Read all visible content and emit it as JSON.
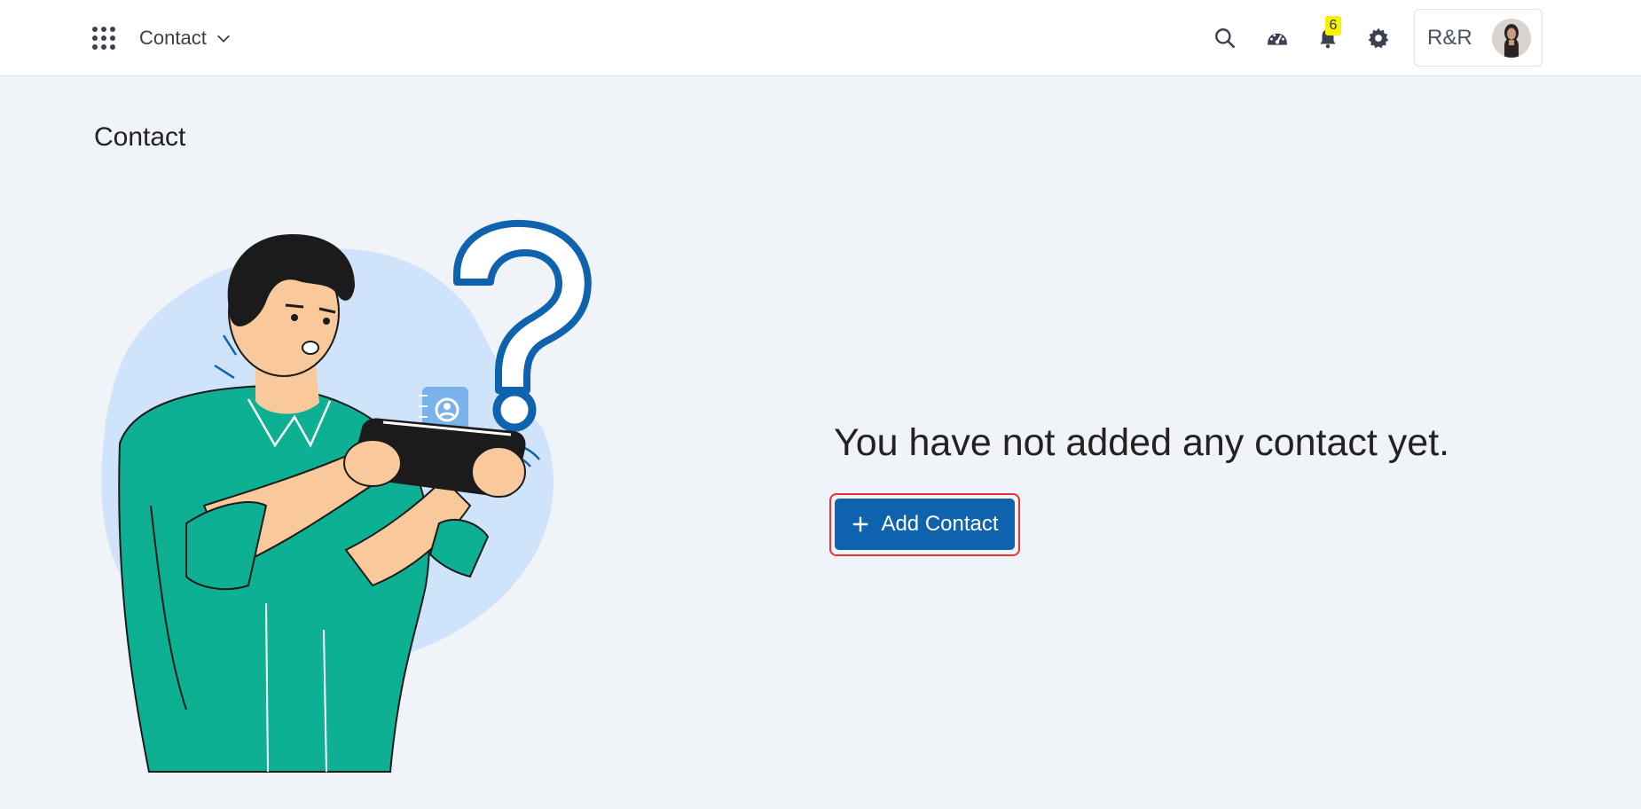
{
  "header": {
    "module_label": "Contact",
    "notification_count": "6",
    "account_label": "R&R"
  },
  "icons": {
    "apps": "apps-grid-icon",
    "module_chevron": "chevron-down-icon",
    "search": "search-icon",
    "dashboard": "speedometer-icon",
    "notifications": "bell-icon",
    "settings": "gear-icon"
  },
  "page": {
    "title": "Contact"
  },
  "empty_state": {
    "message": "You have not added any contact yet.",
    "button_label": "Add Contact"
  },
  "colors": {
    "accent": "#0f62ae",
    "highlight_outline": "#e5353b",
    "badge": "#f6f200",
    "page_bg": "#f0f3f8"
  }
}
